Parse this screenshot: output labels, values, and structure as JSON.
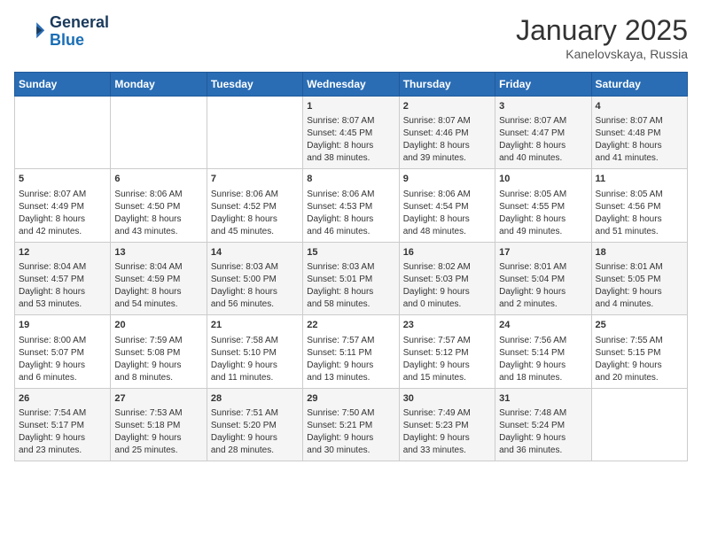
{
  "header": {
    "logo_line1": "General",
    "logo_line2": "Blue",
    "month": "January 2025",
    "location": "Kanelovskaya, Russia"
  },
  "weekdays": [
    "Sunday",
    "Monday",
    "Tuesday",
    "Wednesday",
    "Thursday",
    "Friday",
    "Saturday"
  ],
  "weeks": [
    [
      {
        "day": "",
        "info": ""
      },
      {
        "day": "",
        "info": ""
      },
      {
        "day": "",
        "info": ""
      },
      {
        "day": "1",
        "info": "Sunrise: 8:07 AM\nSunset: 4:45 PM\nDaylight: 8 hours\nand 38 minutes."
      },
      {
        "day": "2",
        "info": "Sunrise: 8:07 AM\nSunset: 4:46 PM\nDaylight: 8 hours\nand 39 minutes."
      },
      {
        "day": "3",
        "info": "Sunrise: 8:07 AM\nSunset: 4:47 PM\nDaylight: 8 hours\nand 40 minutes."
      },
      {
        "day": "4",
        "info": "Sunrise: 8:07 AM\nSunset: 4:48 PM\nDaylight: 8 hours\nand 41 minutes."
      }
    ],
    [
      {
        "day": "5",
        "info": "Sunrise: 8:07 AM\nSunset: 4:49 PM\nDaylight: 8 hours\nand 42 minutes."
      },
      {
        "day": "6",
        "info": "Sunrise: 8:06 AM\nSunset: 4:50 PM\nDaylight: 8 hours\nand 43 minutes."
      },
      {
        "day": "7",
        "info": "Sunrise: 8:06 AM\nSunset: 4:52 PM\nDaylight: 8 hours\nand 45 minutes."
      },
      {
        "day": "8",
        "info": "Sunrise: 8:06 AM\nSunset: 4:53 PM\nDaylight: 8 hours\nand 46 minutes."
      },
      {
        "day": "9",
        "info": "Sunrise: 8:06 AM\nSunset: 4:54 PM\nDaylight: 8 hours\nand 48 minutes."
      },
      {
        "day": "10",
        "info": "Sunrise: 8:05 AM\nSunset: 4:55 PM\nDaylight: 8 hours\nand 49 minutes."
      },
      {
        "day": "11",
        "info": "Sunrise: 8:05 AM\nSunset: 4:56 PM\nDaylight: 8 hours\nand 51 minutes."
      }
    ],
    [
      {
        "day": "12",
        "info": "Sunrise: 8:04 AM\nSunset: 4:57 PM\nDaylight: 8 hours\nand 53 minutes."
      },
      {
        "day": "13",
        "info": "Sunrise: 8:04 AM\nSunset: 4:59 PM\nDaylight: 8 hours\nand 54 minutes."
      },
      {
        "day": "14",
        "info": "Sunrise: 8:03 AM\nSunset: 5:00 PM\nDaylight: 8 hours\nand 56 minutes."
      },
      {
        "day": "15",
        "info": "Sunrise: 8:03 AM\nSunset: 5:01 PM\nDaylight: 8 hours\nand 58 minutes."
      },
      {
        "day": "16",
        "info": "Sunrise: 8:02 AM\nSunset: 5:03 PM\nDaylight: 9 hours\nand 0 minutes."
      },
      {
        "day": "17",
        "info": "Sunrise: 8:01 AM\nSunset: 5:04 PM\nDaylight: 9 hours\nand 2 minutes."
      },
      {
        "day": "18",
        "info": "Sunrise: 8:01 AM\nSunset: 5:05 PM\nDaylight: 9 hours\nand 4 minutes."
      }
    ],
    [
      {
        "day": "19",
        "info": "Sunrise: 8:00 AM\nSunset: 5:07 PM\nDaylight: 9 hours\nand 6 minutes."
      },
      {
        "day": "20",
        "info": "Sunrise: 7:59 AM\nSunset: 5:08 PM\nDaylight: 9 hours\nand 8 minutes."
      },
      {
        "day": "21",
        "info": "Sunrise: 7:58 AM\nSunset: 5:10 PM\nDaylight: 9 hours\nand 11 minutes."
      },
      {
        "day": "22",
        "info": "Sunrise: 7:57 AM\nSunset: 5:11 PM\nDaylight: 9 hours\nand 13 minutes."
      },
      {
        "day": "23",
        "info": "Sunrise: 7:57 AM\nSunset: 5:12 PM\nDaylight: 9 hours\nand 15 minutes."
      },
      {
        "day": "24",
        "info": "Sunrise: 7:56 AM\nSunset: 5:14 PM\nDaylight: 9 hours\nand 18 minutes."
      },
      {
        "day": "25",
        "info": "Sunrise: 7:55 AM\nSunset: 5:15 PM\nDaylight: 9 hours\nand 20 minutes."
      }
    ],
    [
      {
        "day": "26",
        "info": "Sunrise: 7:54 AM\nSunset: 5:17 PM\nDaylight: 9 hours\nand 23 minutes."
      },
      {
        "day": "27",
        "info": "Sunrise: 7:53 AM\nSunset: 5:18 PM\nDaylight: 9 hours\nand 25 minutes."
      },
      {
        "day": "28",
        "info": "Sunrise: 7:51 AM\nSunset: 5:20 PM\nDaylight: 9 hours\nand 28 minutes."
      },
      {
        "day": "29",
        "info": "Sunrise: 7:50 AM\nSunset: 5:21 PM\nDaylight: 9 hours\nand 30 minutes."
      },
      {
        "day": "30",
        "info": "Sunrise: 7:49 AM\nSunset: 5:23 PM\nDaylight: 9 hours\nand 33 minutes."
      },
      {
        "day": "31",
        "info": "Sunrise: 7:48 AM\nSunset: 5:24 PM\nDaylight: 9 hours\nand 36 minutes."
      },
      {
        "day": "",
        "info": ""
      }
    ]
  ]
}
